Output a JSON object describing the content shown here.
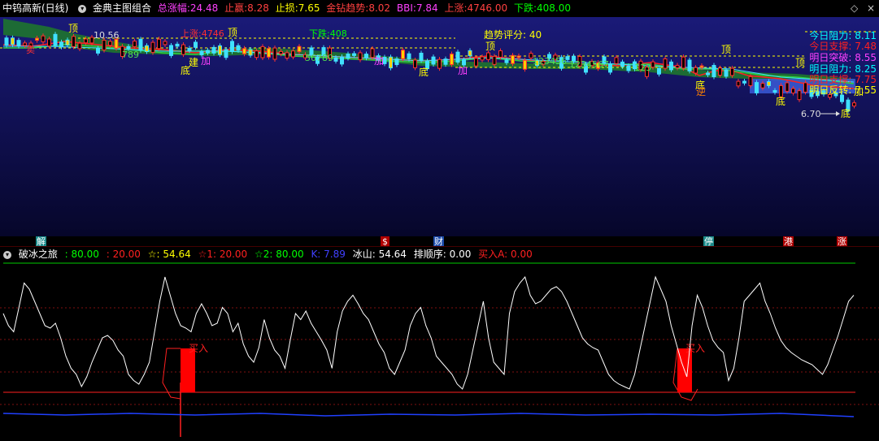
{
  "topbar": {
    "stock_name": "中钨高新(日线)",
    "template": "金典主图组合",
    "zf_label": "总涨幅:",
    "zf_val": "24.48",
    "zy_label": "止赢:",
    "zy_val": "8.28",
    "zs_label": "止损:",
    "zs_val": "7.65",
    "qz_label": "金钻趋势:",
    "qz_val": "8.02",
    "bbi_label": "BBI:",
    "bbi_val": "7.84",
    "sz_label": "上涨:",
    "sz_val": "4746.00",
    "xd_label": "下跌:",
    "xd_val": "408.00"
  },
  "right_panel": {
    "r1": "今日阻力: 8.11",
    "r2": "今日支撑: 7.48",
    "r3": "明日突破: 8.55",
    "r4": "明日阻力: 8.25",
    "r5": "明日支撑: 7.75",
    "r6": "明日反转: 7.55"
  },
  "main_labels": {
    "score": "趋势评分: 40",
    "up": "上涨:4746",
    "down": "下跌:408",
    "high": "10.56",
    "low": "6.70",
    "top": "顶",
    "bottom": "底",
    "add": "加",
    "build": "建",
    "stop": "逆",
    "sell": "卖",
    "seq1": "56789",
    "seq2": "123456",
    "seq3": "789",
    "seq4": "1234567",
    "seq5": "123"
  },
  "event_markers": [
    "解",
    "$",
    "财",
    "停",
    "港",
    "涨"
  ],
  "indicator_bar": {
    "name": "破冰之旅",
    "v1": ": 80.00",
    "v2": ": 20.00",
    "v3": "☆: 54.64",
    "v4": "☆1: 20.00",
    "v5": "☆2: 80.00",
    "v6": "K: 7.89",
    "v7": "冰山: 54.64",
    "v8": "排顺序: 0.00",
    "v9": "买入A: 0.00",
    "buy_label": "买入"
  },
  "colors": {
    "white": "#ffffff",
    "magenta": "#ff40ff",
    "yellow": "#ffff00",
    "red": "#ff2020",
    "green": "#00ff00",
    "cyan": "#00ffff",
    "blue": "#0000ff"
  },
  "chart_data": {
    "type": "line",
    "series": [
      {
        "values": [
          70,
          60,
          55,
          75,
          95,
          90,
          80,
          70,
          60,
          58,
          62,
          50,
          35,
          25,
          20,
          10,
          18,
          30,
          40,
          50,
          52,
          48,
          40,
          35,
          20,
          15,
          12,
          20,
          30,
          55,
          80,
          100,
          85,
          70,
          60,
          58,
          55,
          70,
          78,
          70,
          60,
          62,
          75,
          70,
          55,
          62,
          45,
          35,
          30,
          42,
          65,
          50,
          40,
          35,
          25,
          48,
          70,
          65,
          72,
          62,
          55,
          48,
          40,
          25,
          55,
          72,
          80,
          85,
          78,
          70,
          65,
          55,
          45,
          38,
          25,
          20,
          30,
          40,
          60,
          70,
          75,
          60,
          50,
          35,
          30,
          25,
          20,
          12,
          8,
          20,
          40,
          60,
          80,
          50,
          30,
          25,
          20,
          70,
          88,
          95,
          100,
          85,
          78,
          80,
          85,
          90,
          92,
          88,
          80,
          70,
          60,
          50,
          45,
          42,
          40,
          30,
          20,
          15,
          12,
          10,
          8,
          20,
          40,
          60,
          80,
          100,
          90,
          80,
          60,
          45,
          30,
          18,
          60,
          85,
          75,
          60,
          48,
          42,
          38,
          15,
          25,
          50,
          80,
          85,
          90,
          95,
          80,
          70,
          58,
          48,
          42,
          38,
          35,
          32,
          30,
          28,
          24,
          20,
          28,
          40,
          52,
          66,
          80,
          85
        ]
      }
    ],
    "ylim": [
      0,
      100
    ]
  }
}
